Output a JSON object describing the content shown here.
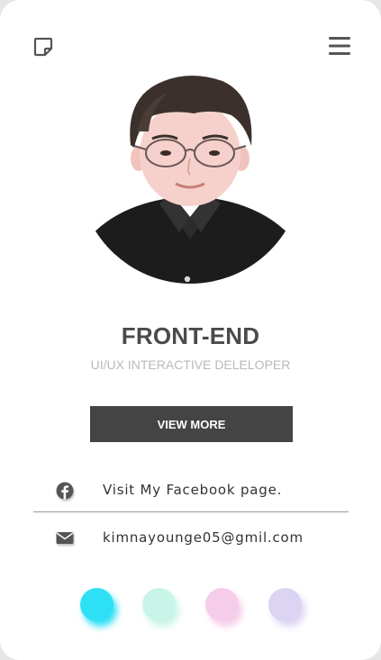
{
  "profile": {
    "title": "FRONT-END",
    "subtitle": "UI/UX INTERACTIVE DELELOPER",
    "button_label": "VIEW MORE",
    "photo_alt": "Profile photo"
  },
  "header": {
    "left_icon": "sticky-note-icon",
    "right_icon": "hamburger-menu-icon"
  },
  "contacts": {
    "facebook": {
      "icon": "facebook-icon",
      "text": "Visit My Facebook page."
    },
    "email": {
      "icon": "envelope-icon",
      "text": "kimnayounge05@gmil.com"
    }
  },
  "theme_colors": {
    "cyan": "#2ee0f5",
    "mint": "#c8f5e8",
    "pink": "#f5cde8",
    "lavender": "#dcd4f3"
  },
  "colors": {
    "button_bg": "#444444",
    "title": "#4a4a4a",
    "subtitle": "#b9b9b9"
  }
}
